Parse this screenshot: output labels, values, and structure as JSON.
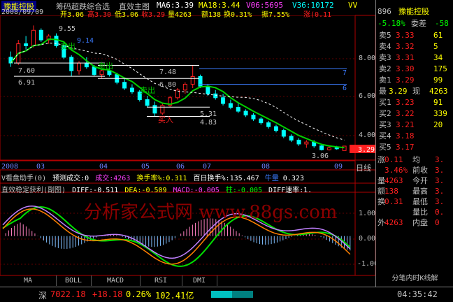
{
  "header": {
    "stock_name": "豫能控股",
    "formula_name": "筹码超跌综合选",
    "view_name": "直效主图",
    "ma6": "MA6:3.39",
    "ma18": "MA18:3.44",
    "v06": "V06:5695",
    "v36": "V36:10172",
    "vvm": "VV"
  },
  "quote_line": {
    "date": "2008/09/09",
    "open": "开3.06",
    "high": "高3.30",
    "low": "低3.06",
    "close": "收3.29",
    "volume": "量4263",
    "amount": "额138",
    "turnover": "换0.31%",
    "amplitude": "振7.55%",
    "change": "涨(0.11"
  },
  "price_annotations": [
    {
      "text": "9.55",
      "color": "#ffffff"
    },
    {
      "text": "7.60",
      "color": "#ffffff"
    },
    {
      "text": "6.91",
      "color": "#ffffff"
    },
    {
      "text": "7.48",
      "color": "#ffffff"
    },
    {
      "text": "6.80",
      "color": "#ffffff"
    },
    {
      "text": "5.31",
      "color": "#ffffff"
    },
    {
      "text": "4.83",
      "color": "#ffffff"
    },
    {
      "text": "3.06",
      "color": "#ffffff"
    },
    {
      "text": "9.14",
      "color": "#3b7bff"
    },
    {
      "text": "7",
      "color": "#3b7bff"
    },
    {
      "text": "6",
      "color": "#3b7bff"
    },
    {
      "text": "卖出",
      "color": "#00c000"
    },
    {
      "text": "卖出",
      "color": "#00c000"
    },
    {
      "text": "卖出",
      "color": "#00c000"
    },
    {
      "text": "买入",
      "color": "#ff2020"
    }
  ],
  "price_axis": [
    "8.00",
    "6.00",
    "4.00"
  ],
  "current_price_tag": "3.29",
  "date_axis": [
    "2008",
    "03",
    "04",
    "05",
    "06",
    "07",
    "08",
    "09"
  ],
  "date_axis_unit": "日线",
  "volume_indicator": {
    "name": "V看盘助手",
    "param": "(0)",
    "forecast": "预测成交:0",
    "volume": "成交:4263",
    "turnover": "换手率%:0.311",
    "hundred_day": "百日换手%:135.467",
    "bull": "牛量",
    "value": "0.323"
  },
  "macd_indicator": {
    "name": "直效稳定获利(副图)",
    "diff": "DIFF:-0.511",
    "dea": "DEA:-0.509",
    "macd": "MACD:-0.005",
    "col": "柱:-0.005",
    "diff_rate": "DIFF速率:1.",
    "axis": [
      "1.00",
      "0.00",
      "-1.00"
    ]
  },
  "watermark": "分析家公式网 www.88gs.com",
  "indicator_tabs": [
    "MA",
    "BOLL",
    "MACD",
    "RSI",
    "DMI"
  ],
  "right_panel": {
    "code": "896",
    "name": "豫能控股",
    "ratio_label": "-5.18%",
    "ratio_tag": "委差",
    "ratio_value": "-58",
    "sell": [
      {
        "label": "卖5",
        "price": "3.33",
        "vol": "61"
      },
      {
        "label": "卖4",
        "price": "3.32",
        "vol": "5"
      },
      {
        "label": "卖3",
        "price": "3.31",
        "vol": "34"
      },
      {
        "label": "卖2",
        "price": "3.30",
        "vol": "175"
      },
      {
        "label": "卖1",
        "price": "3.29",
        "vol": "99"
      }
    ],
    "last": {
      "label": "最",
      "price": "3.29",
      "tag": "现",
      "vol": "4263"
    },
    "buy": [
      {
        "label": "买1",
        "price": "3.23",
        "vol": "91"
      },
      {
        "label": "买2",
        "price": "3.22",
        "vol": "339"
      },
      {
        "label": "买3",
        "price": "3.21",
        "vol": "20"
      },
      {
        "label": "买4",
        "price": "3.18",
        "vol": ""
      },
      {
        "label": "买5",
        "price": "3.17",
        "vol": ""
      }
    ],
    "stats": [
      {
        "a": "涨",
        "b": "0.11",
        "c": "均",
        "d": "3."
      },
      {
        "a": "",
        "b": "3.46%",
        "c": "前收",
        "d": "3."
      },
      {
        "a": "量",
        "b": "4263",
        "c": "今开",
        "d": "3."
      },
      {
        "a": "额",
        "b": "138",
        "c": "最高",
        "d": "3."
      },
      {
        "a": "换",
        "b": "0.31",
        "c": "最低",
        "d": "3."
      },
      {
        "a": "",
        "b": "",
        "c": "量比",
        "d": "0."
      },
      {
        "a": "外",
        "b": "4263",
        "c": "内盘",
        "d": "0"
      }
    ],
    "bottom_label": "分笔内时K线解"
  },
  "status_bar": {
    "index_name": "深",
    "index_value": "7022.18",
    "change": "+18.18",
    "pct": "0.26%",
    "amount": "102.41亿",
    "time": "04:35:42"
  },
  "chart_data": {
    "type": "candlestick",
    "title": "豫能控股 日线",
    "price_ylim": [
      2.6,
      10.0
    ],
    "x": [
      "2008",
      "03",
      "04",
      "05",
      "06",
      "07",
      "08",
      "09"
    ],
    "candles": [
      [
        7.9,
        8.2,
        7.4,
        7.6
      ],
      [
        7.6,
        8.8,
        7.5,
        8.6
      ],
      [
        8.6,
        9.0,
        8.3,
        8.5
      ],
      [
        8.5,
        9.55,
        8.4,
        9.3
      ],
      [
        9.3,
        9.4,
        8.7,
        8.8
      ],
      [
        8.8,
        9.1,
        8.6,
        9.0
      ],
      [
        9.0,
        9.14,
        8.4,
        8.5
      ],
      [
        8.5,
        8.7,
        7.8,
        7.9
      ],
      [
        7.9,
        8.0,
        6.91,
        7.2
      ],
      [
        7.2,
        7.7,
        7.0,
        7.6
      ],
      [
        7.6,
        7.9,
        7.3,
        7.4
      ],
      [
        7.4,
        7.5,
        6.9,
        7.0
      ],
      [
        7.0,
        7.3,
        6.8,
        7.2
      ],
      [
        7.2,
        7.48,
        6.9,
        7.0
      ],
      [
        7.0,
        7.1,
        6.5,
        6.6
      ],
      [
        6.6,
        6.8,
        6.2,
        6.3
      ],
      [
        6.3,
        6.5,
        6.0,
        6.1
      ],
      [
        6.1,
        6.2,
        5.6,
        5.7
      ],
      [
        5.7,
        5.9,
        5.31,
        5.4
      ],
      [
        5.4,
        5.6,
        4.83,
        5.0
      ],
      [
        5.0,
        5.5,
        4.9,
        5.4
      ],
      [
        5.4,
        5.9,
        5.3,
        5.8
      ],
      [
        5.8,
        6.3,
        5.7,
        6.2
      ],
      [
        6.2,
        6.6,
        6.0,
        6.5
      ],
      [
        6.5,
        7.48,
        6.3,
        6.9
      ],
      [
        6.9,
        7.0,
        6.3,
        6.4
      ],
      [
        6.4,
        6.5,
        5.9,
        6.0
      ],
      [
        6.0,
        6.2,
        5.7,
        5.8
      ],
      [
        5.8,
        6.0,
        5.4,
        5.5
      ],
      [
        5.5,
        5.7,
        5.2,
        5.3
      ],
      [
        5.3,
        5.5,
        5.0,
        5.1
      ],
      [
        5.1,
        5.2,
        4.8,
        4.9
      ],
      [
        4.9,
        5.0,
        4.6,
        4.7
      ],
      [
        4.7,
        4.8,
        4.4,
        4.5
      ],
      [
        4.5,
        4.6,
        4.2,
        4.3
      ],
      [
        4.3,
        4.4,
        4.0,
        4.1
      ],
      [
        4.1,
        4.2,
        3.7,
        3.8
      ],
      [
        3.8,
        3.9,
        3.5,
        3.6
      ],
      [
        3.6,
        3.7,
        3.3,
        3.4
      ],
      [
        3.4,
        3.6,
        3.2,
        3.5
      ],
      [
        3.5,
        3.6,
        3.2,
        3.3
      ],
      [
        3.3,
        3.4,
        3.06,
        3.1
      ],
      [
        3.1,
        3.3,
        3.06,
        3.2
      ],
      [
        3.2,
        3.3,
        3.1,
        3.15
      ],
      [
        3.06,
        3.3,
        3.06,
        3.29
      ]
    ],
    "macd_ylim": [
      -1.3,
      1.5
    ]
  }
}
